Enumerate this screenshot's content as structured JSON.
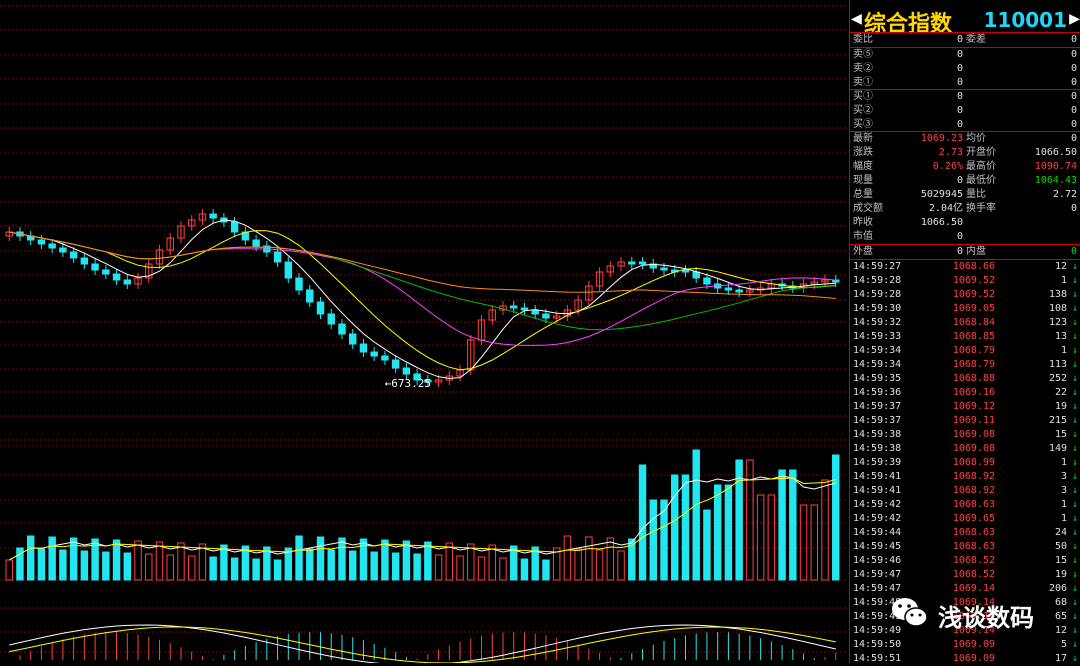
{
  "header": {
    "name": "综合指数",
    "code": "110001",
    "left_arrow": "◀",
    "right_arrow": "▶"
  },
  "order_book": {
    "ratio": {
      "label": "委比",
      "value": "0",
      "diff_label": "委差",
      "diff_value": "0"
    },
    "sells": [
      {
        "label": "卖⑤",
        "price": "0",
        "vol": "0"
      },
      {
        "label": "卖②",
        "price": "0",
        "vol": "0"
      },
      {
        "label": "卖①",
        "price": "0",
        "vol": "0"
      }
    ],
    "buys": [
      {
        "label": "买①",
        "price": "0",
        "vol": "0"
      },
      {
        "label": "买②",
        "price": "0",
        "vol": "0"
      },
      {
        "label": "买③",
        "price": "0",
        "vol": "0"
      }
    ]
  },
  "quote": [
    {
      "l1": "最新",
      "v1": "1069.23",
      "c1": "red",
      "l2": "均价",
      "v2": "0",
      "c2": "wht"
    },
    {
      "l1": "涨跌",
      "v1": "2.73",
      "c1": "red",
      "l2": "开盘价",
      "v2": "1066.50",
      "c2": "wht"
    },
    {
      "l1": "幅度",
      "v1": "0.26%",
      "c1": "red",
      "l2": "最高价",
      "v2": "1090.74",
      "c2": "red"
    },
    {
      "l1": "现量",
      "v1": "0",
      "c1": "wht",
      "l2": "最低价",
      "v2": "1064.43",
      "c2": "grn"
    },
    {
      "l1": "总量",
      "v1": "5029945",
      "c1": "wht",
      "l2": "量比",
      "v2": "2.72",
      "c2": "wht"
    },
    {
      "l1": "成交额",
      "v1": "2.04亿",
      "c1": "wht",
      "l2": "换手率",
      "v2": "0",
      "c2": "wht"
    },
    {
      "l1": "昨收",
      "v1": "1066.50",
      "c1": "wht",
      "l2": "",
      "v2": "",
      "c2": "wht"
    },
    {
      "l1": "市值",
      "v1": "0",
      "c1": "wht",
      "l2": "",
      "v2": "",
      "c2": "wht"
    }
  ],
  "outer_inner": {
    "outer_label": "外盘",
    "outer_value": "0",
    "inner_label": "内盘",
    "inner_value": "0"
  },
  "ticks": [
    {
      "time": "14:59:27",
      "price": "1068.66",
      "vol": "12",
      "dir": "↓"
    },
    {
      "time": "14:59:28",
      "price": "1069.52",
      "vol": "1",
      "dir": "↓"
    },
    {
      "time": "14:59:28",
      "price": "1069.52",
      "vol": "138",
      "dir": "↓"
    },
    {
      "time": "14:59:30",
      "price": "1069.05",
      "vol": "108",
      "dir": "↓"
    },
    {
      "time": "14:59:32",
      "price": "1068.84",
      "vol": "123",
      "dir": "↓"
    },
    {
      "time": "14:59:33",
      "price": "1068.85",
      "vol": "13",
      "dir": "↓"
    },
    {
      "time": "14:59:34",
      "price": "1068.79",
      "vol": "1",
      "dir": "↓"
    },
    {
      "time": "14:59:34",
      "price": "1068.79",
      "vol": "113",
      "dir": "↓"
    },
    {
      "time": "14:59:35",
      "price": "1068.88",
      "vol": "252",
      "dir": "↓"
    },
    {
      "time": "14:59:36",
      "price": "1069.16",
      "vol": "22",
      "dir": "↓"
    },
    {
      "time": "14:59:37",
      "price": "1069.12",
      "vol": "19",
      "dir": "↓"
    },
    {
      "time": "14:59:37",
      "price": "1069.11",
      "vol": "215",
      "dir": "↓"
    },
    {
      "time": "14:59:38",
      "price": "1069.08",
      "vol": "15",
      "dir": "↓"
    },
    {
      "time": "14:59:38",
      "price": "1069.08",
      "vol": "149",
      "dir": "↓"
    },
    {
      "time": "14:59:39",
      "price": "1068.99",
      "vol": "1",
      "dir": "↓"
    },
    {
      "time": "14:59:41",
      "price": "1068.92",
      "vol": "3",
      "dir": "↓"
    },
    {
      "time": "14:59:41",
      "price": "1068.92",
      "vol": "3",
      "dir": "↓"
    },
    {
      "time": "14:59:42",
      "price": "1068.63",
      "vol": "1",
      "dir": "↓"
    },
    {
      "time": "14:59:42",
      "price": "1069.65",
      "vol": "1",
      "dir": "↓"
    },
    {
      "time": "14:59:44",
      "price": "1068.63",
      "vol": "24",
      "dir": "↓"
    },
    {
      "time": "14:59:45",
      "price": "1068.63",
      "vol": "50",
      "dir": "↓"
    },
    {
      "time": "14:59:46",
      "price": "1068.52",
      "vol": "15",
      "dir": "↓"
    },
    {
      "time": "14:59:47",
      "price": "1068.52",
      "vol": "19",
      "dir": "↓"
    },
    {
      "time": "14:59:47",
      "price": "1069.14",
      "vol": "206",
      "dir": "↓"
    },
    {
      "time": "14:59:48",
      "price": "1069.14",
      "vol": "68",
      "dir": "↓"
    },
    {
      "time": "14:59:49",
      "price": "1069.14",
      "vol": "65",
      "dir": "↓"
    },
    {
      "time": "14:59:49",
      "price": "1069.14",
      "vol": "12",
      "dir": "↓"
    },
    {
      "time": "14:59:50",
      "price": "1069.09",
      "vol": "5",
      "dir": "↓"
    },
    {
      "time": "14:59:51",
      "price": "1069.09",
      "vol": "17",
      "dir": "↓"
    }
  ],
  "chart": {
    "low_label": "673.25"
  },
  "watermark": {
    "text": "浅谈数码",
    "icon": "wechat-icon"
  },
  "colors": {
    "up": "#ff4040",
    "down": "#21e6f0",
    "grid": "#8b0000",
    "ma5": "#ffffff",
    "ma10": "#ffff00",
    "ma20": "#ff40ff",
    "ma30": "#00c000",
    "ma60": "#ff8c1a"
  }
}
